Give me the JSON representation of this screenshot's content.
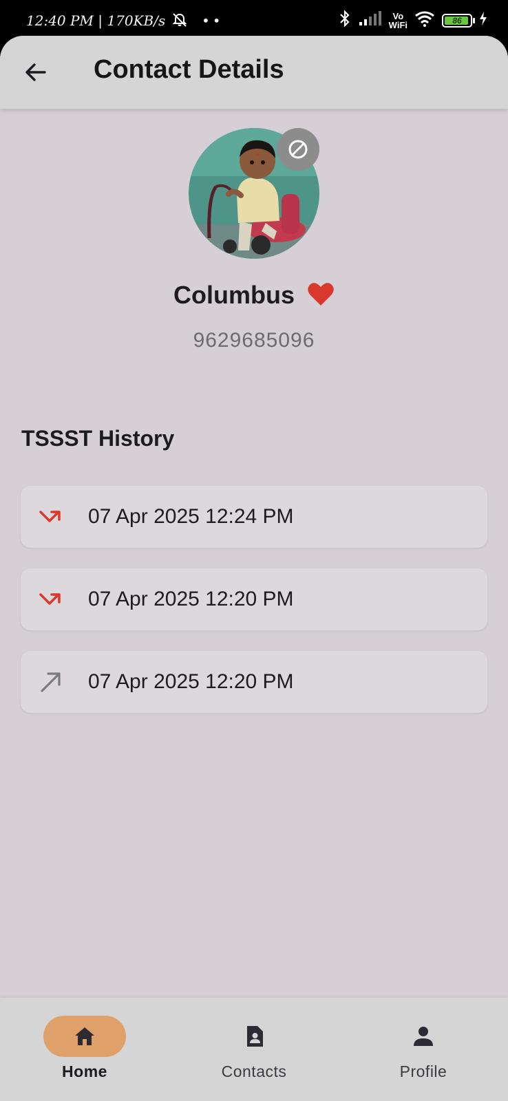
{
  "status_bar": {
    "time": "12:40 PM",
    "network_speed": "170KB/s",
    "battery_level": "86",
    "vowifi_top": "Vo",
    "vowifi_bottom": "WiFi"
  },
  "app_bar": {
    "title": "Contact Details"
  },
  "contact": {
    "name": "Columbus",
    "phone": "9629685096",
    "favorite": true
  },
  "history": {
    "title": "TSSST History",
    "items": [
      {
        "direction": "incoming",
        "time": "07 Apr 2025 12:24 PM",
        "color": "#d9382c"
      },
      {
        "direction": "incoming",
        "time": "07 Apr 2025 12:20 PM",
        "color": "#d9382c"
      },
      {
        "direction": "outgoing",
        "time": "07 Apr 2025 12:20 PM",
        "color": "#7a7a7a"
      }
    ]
  },
  "bottom_nav": {
    "items": [
      {
        "label": "Home",
        "icon": "home-icon",
        "active": true
      },
      {
        "label": "Contacts",
        "icon": "contact-card-icon",
        "active": false
      },
      {
        "label": "Profile",
        "icon": "person-icon",
        "active": false
      }
    ]
  },
  "colors": {
    "background": "#d6d0d6",
    "app_bar": "#d5d5d5",
    "accent": "#e0a06a",
    "favorite": "#d9382c"
  }
}
